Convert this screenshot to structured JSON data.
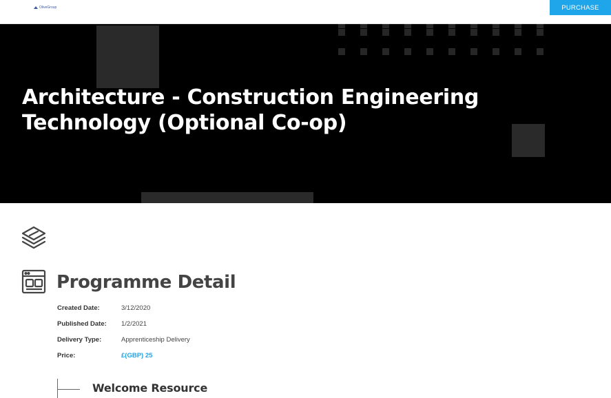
{
  "header": {
    "logo_text": "OliveGroup",
    "purchase_label": "PURCHASE"
  },
  "hero": {
    "title": "Architecture - Construction Engineering Technology (Optional Co-op)"
  },
  "programme": {
    "heading": "Programme Detail",
    "details": [
      {
        "label": "Created Date:",
        "value": "3/12/2020"
      },
      {
        "label": "Published Date:",
        "value": "1/2/2021"
      },
      {
        "label": "Delivery Type:",
        "value": "Apprenticeship Delivery"
      },
      {
        "label": "Price:",
        "value": "£(GBP) 25"
      }
    ]
  },
  "resources": {
    "welcome_title": "Welcome Resource"
  },
  "icons": {
    "stack": "layers-icon",
    "detail": "browser-window-icon"
  },
  "colors": {
    "accent": "#1ea5ea",
    "hero_bg": "#000000",
    "heading": "#444444"
  }
}
